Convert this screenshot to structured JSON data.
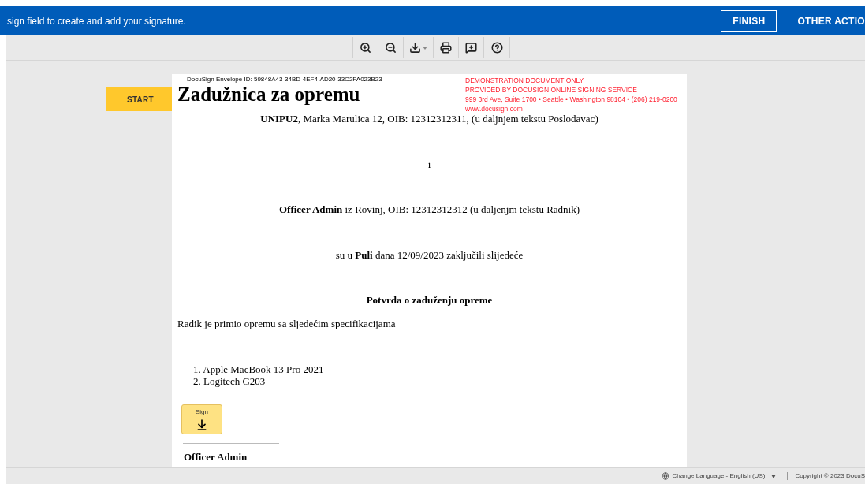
{
  "banner": {
    "message": "sign field to create and add your signature.",
    "finish": "FINISH",
    "other_actions": "OTHER ACTIO"
  },
  "toolbar": [
    {
      "kind": "zoom-in"
    },
    {
      "kind": "zoom-out"
    },
    {
      "kind": "download"
    },
    {
      "kind": "print"
    },
    {
      "kind": "comment"
    },
    {
      "kind": "help"
    }
  ],
  "start_button": "START",
  "document": {
    "envelope_id": "DocuSign Envelope ID: 59848A43-34BD-4EF4-AD20-33C2FA023B23",
    "title": "Zadužnica za opremu",
    "demo_notice": [
      "DEMONSTRATION DOCUMENT ONLY",
      "PROVIDED BY DOCUSIGN ONLINE SIGNING SERVICE",
      "999 3rd Ave, Suite 1700  • Seattle • Washington 98104 • (206) 219-0200",
      "www.docusign.com"
    ],
    "paragraphs": [
      {
        "kind": "center",
        "text": "**UNIPU2,** Marka Marulica 12, OIB: 12312312311, (u daljnjem tekstu Poslodavac)"
      },
      {
        "kind": "center",
        "text": "i"
      },
      {
        "kind": "center",
        "text": "**Officer Admin** iz Rovinj, OIB: 12312312312 (u daljenjm tekstu Radnik)"
      },
      {
        "kind": "center",
        "text": "su u **Puli** dana 12/09/2023 zaključili slijedeće"
      },
      {
        "kind": "heading",
        "text": "Potvrda o zaduženju opreme"
      },
      {
        "kind": "left",
        "text": "Radik je primio opremu sa sljedećim specifikacijama"
      }
    ],
    "items": [
      "1. Apple MacBook 13 Pro 2021",
      "2. Logitech G203"
    ],
    "sign_field": "Sign",
    "signer": "Officer Admin"
  },
  "footer": {
    "language": "Change Language - English (US)",
    "copyright": "Copyright © 2023 DocuS"
  }
}
